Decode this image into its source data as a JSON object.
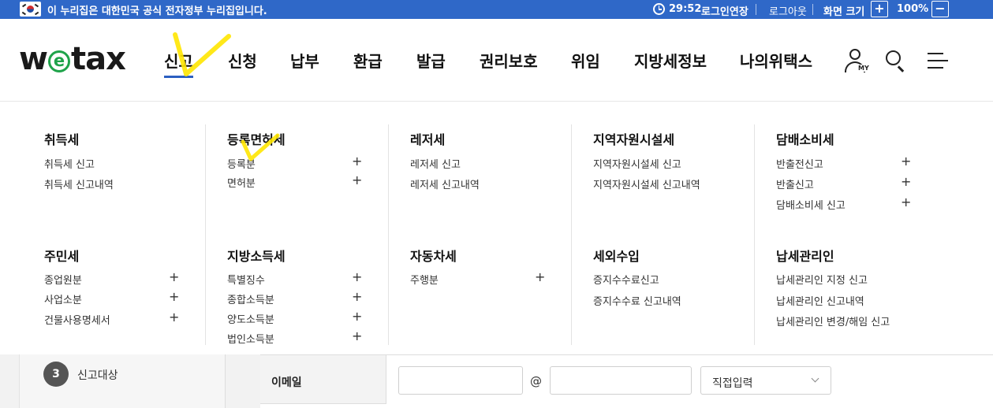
{
  "gov_banner": {
    "text": "이 누리집은 대한민국 공식 전자정부 누리집입니다.",
    "timer": "29:52",
    "extend_label": "로그인연장",
    "logout_label": "로그아웃",
    "zoom_label": "화면 크기",
    "zoom_in": "+",
    "zoom_value": "100%",
    "zoom_out": "−"
  },
  "logo": {
    "prefix": "w",
    "e_letter": "e",
    "suffix": "tax"
  },
  "nav": [
    {
      "label": "신고"
    },
    {
      "label": "신청"
    },
    {
      "label": "납부"
    },
    {
      "label": "환급"
    },
    {
      "label": "발급"
    },
    {
      "label": "권리보호"
    },
    {
      "label": "위임"
    },
    {
      "label": "지방세정보"
    },
    {
      "label": "나의위택스"
    }
  ],
  "user_icon_label": "MY",
  "menu": {
    "row1": [
      {
        "title": "취득세",
        "items": [
          "취득세 신고",
          "취득세 신고내역"
        ]
      },
      {
        "title": "등록면허세",
        "items": [
          "등록분",
          "면허분"
        ]
      },
      {
        "title": "레저세",
        "items": [
          "레저세 신고",
          "레저세 신고내역"
        ]
      },
      {
        "title": "지역자원시설세",
        "items": [
          "지역자원시설세 신고",
          "지역자원시설세 신고내역"
        ]
      },
      {
        "title": "담배소비세",
        "items": [
          "반출전신고",
          "반출신고",
          "담배소비세 신고"
        ]
      }
    ],
    "row2": [
      {
        "title": "주민세",
        "items": [
          "종업원분",
          "사업소분",
          "건물사용명세서"
        ]
      },
      {
        "title": "지방소득세",
        "items": [
          "특별징수",
          "종합소득분",
          "양도소득분",
          "법인소득분"
        ]
      },
      {
        "title": "자동차세",
        "items": [
          "주행분"
        ]
      },
      {
        "title": "세외수입",
        "items": [
          "증지수수료신고",
          "증지수수료 신고내역"
        ]
      },
      {
        "title": "납세관리인",
        "items": [
          "납세관리인 지정 신고",
          "납세관리인 신고내역",
          "납세관리인 변경/해임 신고"
        ]
      }
    ],
    "plus_symbol": "+"
  },
  "underlying_page": {
    "step_number": "3",
    "step_label": "신고대상",
    "email_label": "이메일",
    "at_symbol": "@",
    "domain_select": "직접입력"
  },
  "colors": {
    "gov_bar": "#2f68c8",
    "active_underline": "#2b5fc1",
    "logo_e": "#1fa34a",
    "annotation": "#ffe600"
  }
}
